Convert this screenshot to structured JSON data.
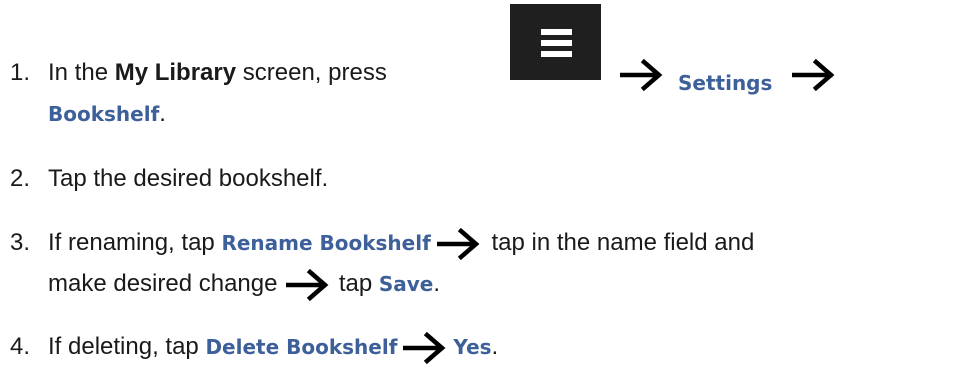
{
  "steps": [
    {
      "number": "1.",
      "text_a": "In the ",
      "text_b": "My Library",
      "text_c": " screen, press ",
      "link_1": "Settings",
      "link_2": "Bookshelf",
      "text_d": "."
    },
    {
      "number": "2.",
      "text_a": "Tap the desired bookshelf."
    },
    {
      "number": "3.",
      "text_a": "If renaming, tap ",
      "link_1": "Rename Bookshelf",
      "text_b": " tap in the name field and",
      "text_c": "make desired change ",
      "text_d": " tap ",
      "link_2": "Save",
      "text_e": "."
    },
    {
      "number": "4.",
      "text_a": "If deleting, tap ",
      "link_1": "Delete Bookshelf",
      "link_2": "Yes",
      "text_b": "."
    }
  ],
  "icons": {
    "menu": "hamburger-menu-icon",
    "arrow": "right-arrow-icon"
  },
  "colors": {
    "text": "#1a1a1a",
    "ui_label": "#3d5f9a",
    "menu_button_bg": "#1f1f1f",
    "menu_button_fg": "#ffffff",
    "arrow": "#000000"
  }
}
